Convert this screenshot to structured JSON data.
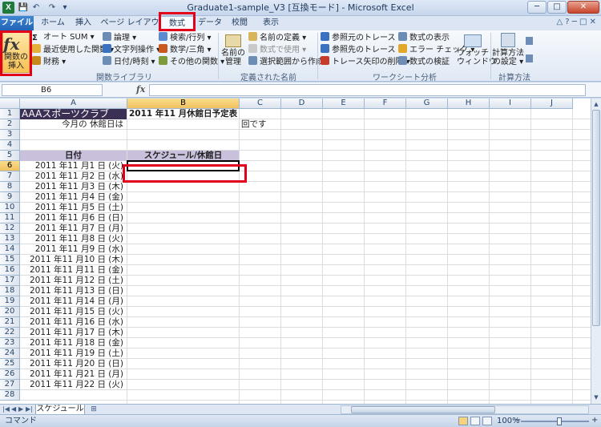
{
  "window": {
    "title": "Graduate1-sample_V3 [互換モード] - Microsoft Excel",
    "app_icon": "X",
    "minimize": "─",
    "maximize": "□",
    "close": "✕"
  },
  "qat": {
    "save": "💾",
    "undo": "↶",
    "redo": "↷",
    "customize": "▾"
  },
  "tabs": [
    "ファイル",
    "ホーム",
    "挿入",
    "ページ レイアウト",
    "数式",
    "データ",
    "校閲",
    "表示"
  ],
  "active_tab": "数式",
  "ribbon": {
    "insert_function": "関数の\n挿入",
    "library": {
      "autosum": "オート SUM ▾",
      "recent": "最近使用した関数 ▾",
      "financial": "財務 ▾",
      "logical": "論理 ▾",
      "text": "文字列操作 ▾",
      "datetime": "日付/時刻 ▾",
      "lookup": "検索/行列 ▾",
      "math": "数学/三角 ▾",
      "more": "その他の関数 ▾",
      "label": "関数ライブラリ"
    },
    "names": {
      "name_manager": "名前の\n管理",
      "define": "名前の定義 ▾",
      "use_in_formula": "数式で使用 ▾",
      "create_from_selection": "選択範囲から作成",
      "label": "定義された名前"
    },
    "audit": {
      "trace_precedents": "参照元のトレース",
      "trace_dependents": "参照先のトレース",
      "remove_arrows": "トレース矢印の削除 ▾",
      "show_formulas": "数式の表示",
      "error_check": "エラー チェック ▾",
      "evaluate": "数式の検証",
      "watch": "ウォッチ\nウィンドウ",
      "label": "ワークシート分析"
    },
    "calc": {
      "options": "計算方法\nの設定 ▾",
      "label": "計算方法"
    }
  },
  "formula_bar": {
    "name_box": "B6",
    "fx": "fx",
    "value": ""
  },
  "columns": [
    "A",
    "B",
    "C",
    "D",
    "E",
    "F",
    "G",
    "H",
    "I",
    "J"
  ],
  "selected_column": "B",
  "rows": [
    "1",
    "2",
    "3",
    "4",
    "5",
    "6",
    "7",
    "8",
    "9",
    "10",
    "11",
    "12",
    "13",
    "14",
    "15",
    "16",
    "17",
    "18",
    "19",
    "20",
    "21",
    "22",
    "23",
    "24",
    "25",
    "26",
    "27",
    "28"
  ],
  "selected_row": "6",
  "cells": {
    "A1": "AAAスポーツクラブ",
    "B1": "2011 年11 月休館日予定表",
    "A2": "今月の 休館日は",
    "C2": "回です",
    "A5": "日付",
    "B5": "スケジュール/休館日"
  },
  "dates": [
    "2011 年11 月1 日 (火)",
    "2011 年11 月2 日 (水)",
    "2011 年11 月3 日 (木)",
    "2011 年11 月4 日 (金)",
    "2011 年11 月5 日 (土)",
    "2011 年11 月6 日 (日)",
    "2011 年11 月7 日 (月)",
    "2011 年11 月8 日 (火)",
    "2011 年11 月9 日 (水)",
    "2011 年11 月10 日 (木)",
    "2011 年11 月11 日 (金)",
    "2011 年11 月12 日 (土)",
    "2011 年11 月13 日 (日)",
    "2011 年11 月14 日 (月)",
    "2011 年11 月15 日 (火)",
    "2011 年11 月16 日 (水)",
    "2011 年11 月17 日 (木)",
    "2011 年11 月18 日 (金)",
    "2011 年11 月19 日 (土)",
    "2011 年11 月20 日 (日)",
    "2011 年11 月21 日 (月)",
    "2011 年11 月22 日 (火)"
  ],
  "sheet_tab": "スケジュール",
  "status": {
    "mode": "コマンド",
    "zoom": "100%",
    "zoom_out": "−",
    "zoom_in": "+"
  },
  "colors": {
    "title_bg": "#3b2f54",
    "header_bg": "#c9c1dc",
    "highlight": "#e3001b",
    "file_tab": "#2263b5"
  }
}
